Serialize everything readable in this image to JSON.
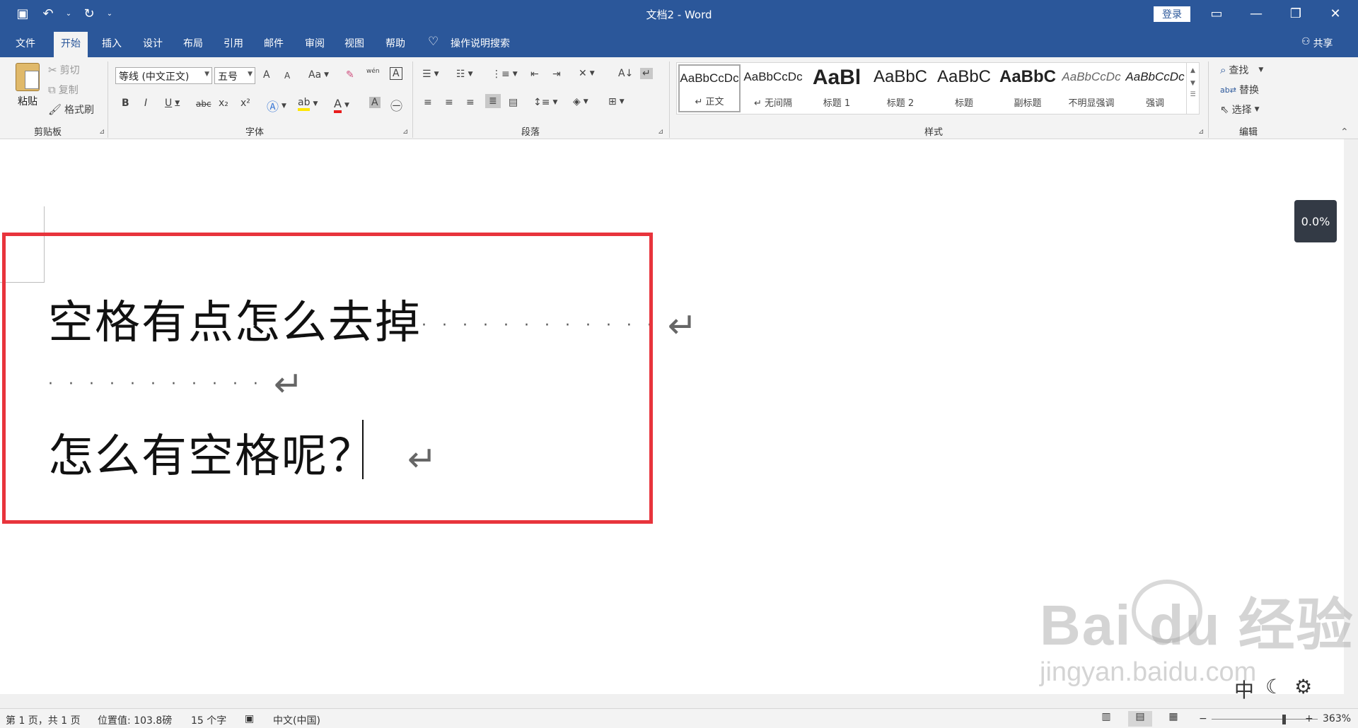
{
  "titlebar": {
    "title": "文档2  -  Word",
    "login": "登录",
    "qat": {
      "save_icon": "save-icon",
      "undo_icon": "undo-icon",
      "redo_icon": "redo-icon"
    },
    "bg": "#2b579a"
  },
  "tabs": [
    {
      "label": "文件"
    },
    {
      "label": "开始"
    },
    {
      "label": "插入"
    },
    {
      "label": "设计"
    },
    {
      "label": "布局"
    },
    {
      "label": "引用"
    },
    {
      "label": "邮件"
    },
    {
      "label": "审阅"
    },
    {
      "label": "视图"
    },
    {
      "label": "帮助"
    }
  ],
  "tell_me": "操作说明搜索",
  "share": "共享",
  "ribbon": {
    "clipboard": {
      "paste": "粘贴",
      "cut": "剪切",
      "copy": "复制",
      "format_painter": "格式刷",
      "label": "剪贴板"
    },
    "font": {
      "name": "等线 (中文正文)",
      "size": "五号",
      "label": "字体",
      "bold": "B",
      "italic": "I",
      "underline": "U",
      "strike": "abc",
      "sub": "x₂",
      "sup": "x²",
      "grow": "A",
      "shrink": "A",
      "case": "Aa",
      "phonetic": "wén",
      "border_char": "A",
      "color_a": "A",
      "shade_a": "A"
    },
    "paragraph": {
      "label": "段落"
    },
    "styles": {
      "label": "样式",
      "items": [
        {
          "sample": "AaBbCcDc",
          "name": "↵ 正文"
        },
        {
          "sample": "AaBbCcDc",
          "name": "↵ 无间隔"
        },
        {
          "sample": "AaBl",
          "name": "标题 1"
        },
        {
          "sample": "AaBbC",
          "name": "标题 2"
        },
        {
          "sample": "AaBbC",
          "name": "标题"
        },
        {
          "sample": "AaBbC",
          "name": "副标题"
        },
        {
          "sample": "AaBbCcDc",
          "name": "不明显强调"
        },
        {
          "sample": "AaBbCcDc",
          "name": "强调"
        }
      ]
    },
    "editing": {
      "find": "查找",
      "replace": "替换",
      "select": "选择",
      "label": "编辑"
    }
  },
  "document": {
    "line1": "空格有点怎么去掉",
    "line1_dots": "············",
    "line2_dots": "···········",
    "line3": "怎么有空格呢？",
    "para_mark": "↵"
  },
  "badge": "0.0%",
  "watermark": {
    "brand": "Bai du 经验",
    "url": "jingyan.baidu.com"
  },
  "statusbar": {
    "page": "第 1 页，共 1 页",
    "position": "位置值: 103.8磅",
    "words": "15 个字",
    "language": "中文(中国)",
    "zoom": "363%",
    "minus": "−",
    "plus": "+"
  }
}
